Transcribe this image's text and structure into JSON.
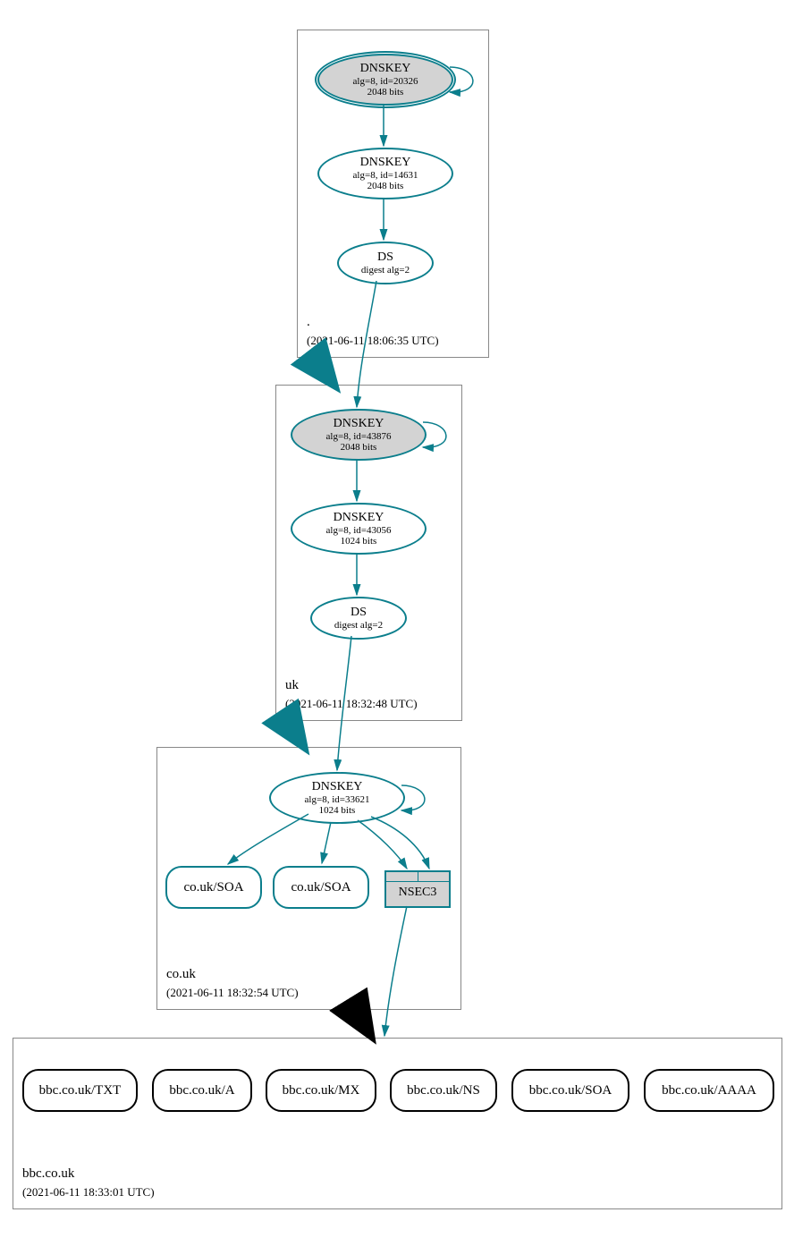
{
  "zones": {
    "root": {
      "label": ".",
      "timestamp": "(2021-06-11 18:06:35 UTC)"
    },
    "uk": {
      "label": "uk",
      "timestamp": "(2021-06-11 18:32:48 UTC)"
    },
    "couk": {
      "label": "co.uk",
      "timestamp": "(2021-06-11 18:32:54 UTC)"
    },
    "bbc": {
      "label": "bbc.co.uk",
      "timestamp": "(2021-06-11 18:33:01 UTC)"
    }
  },
  "nodes": {
    "root_ksk": {
      "title": "DNSKEY",
      "line2": "alg=8, id=20326",
      "line3": "2048 bits"
    },
    "root_zsk": {
      "title": "DNSKEY",
      "line2": "alg=8, id=14631",
      "line3": "2048 bits"
    },
    "root_ds": {
      "title": "DS",
      "line2": "digest alg=2"
    },
    "uk_ksk": {
      "title": "DNSKEY",
      "line2": "alg=8, id=43876",
      "line3": "2048 bits"
    },
    "uk_zsk": {
      "title": "DNSKEY",
      "line2": "alg=8, id=43056",
      "line3": "1024 bits"
    },
    "uk_ds": {
      "title": "DS",
      "line2": "digest alg=2"
    },
    "couk_key": {
      "title": "DNSKEY",
      "line2": "alg=8, id=33621",
      "line3": "1024 bits"
    },
    "couk_soa1": {
      "title": "co.uk/SOA"
    },
    "couk_soa2": {
      "title": "co.uk/SOA"
    },
    "nsec3": {
      "title": "NSEC3"
    },
    "bbc_txt": {
      "title": "bbc.co.uk/TXT"
    },
    "bbc_a": {
      "title": "bbc.co.uk/A"
    },
    "bbc_mx": {
      "title": "bbc.co.uk/MX"
    },
    "bbc_ns": {
      "title": "bbc.co.uk/NS"
    },
    "bbc_soa": {
      "title": "bbc.co.uk/SOA"
    },
    "bbc_aaaa": {
      "title": "bbc.co.uk/AAAA"
    }
  }
}
